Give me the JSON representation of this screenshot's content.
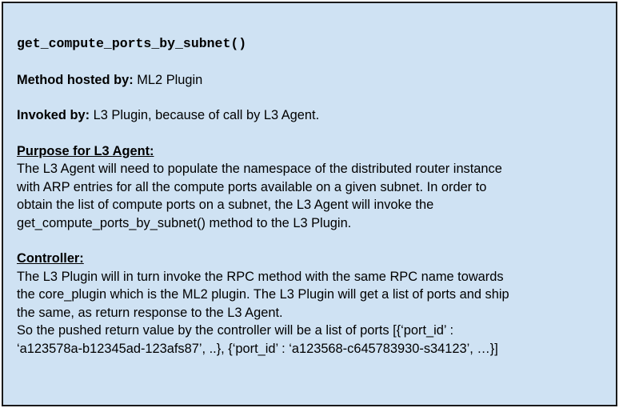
{
  "method_name": "get_compute_ports_by_subnet()",
  "hosted": {
    "label": "Method hosted by:",
    "value": "ML2 Plugin"
  },
  "invoked": {
    "label": "Invoked by:",
    "value": "L3 Plugin, because of call by L3 Agent."
  },
  "purpose": {
    "heading": "Purpose for L3 Agent:",
    "lines": [
      "The L3 Agent will need to populate the namespace of the distributed router instance",
      "with ARP entries for all the compute ports available on a given subnet.  In order to",
      "obtain the list of compute ports on a subnet, the L3 Agent will invoke the",
      "get_compute_ports_by_subnet() method to the L3 Plugin."
    ]
  },
  "controller": {
    "heading": "Controller:",
    "lines": [
      "The L3 Plugin will in turn invoke the RPC method with the same RPC name towards",
      "the core_plugin which is the ML2 plugin.  The L3 Plugin will get a list of ports and ship",
      "the same, as return response to the L3 Agent.",
      "So the pushed return value by the controller will be a list of ports [{‘port_id’ :",
      "‘a123578a-b12345ad-123afs87’, ..}, {‘port_id’ : ‘a123568-c645783930-s34123’, …}]"
    ]
  },
  "colors": {
    "card_background": "#cfe2f3",
    "border": "#1a1a1a",
    "text": "#000000"
  }
}
